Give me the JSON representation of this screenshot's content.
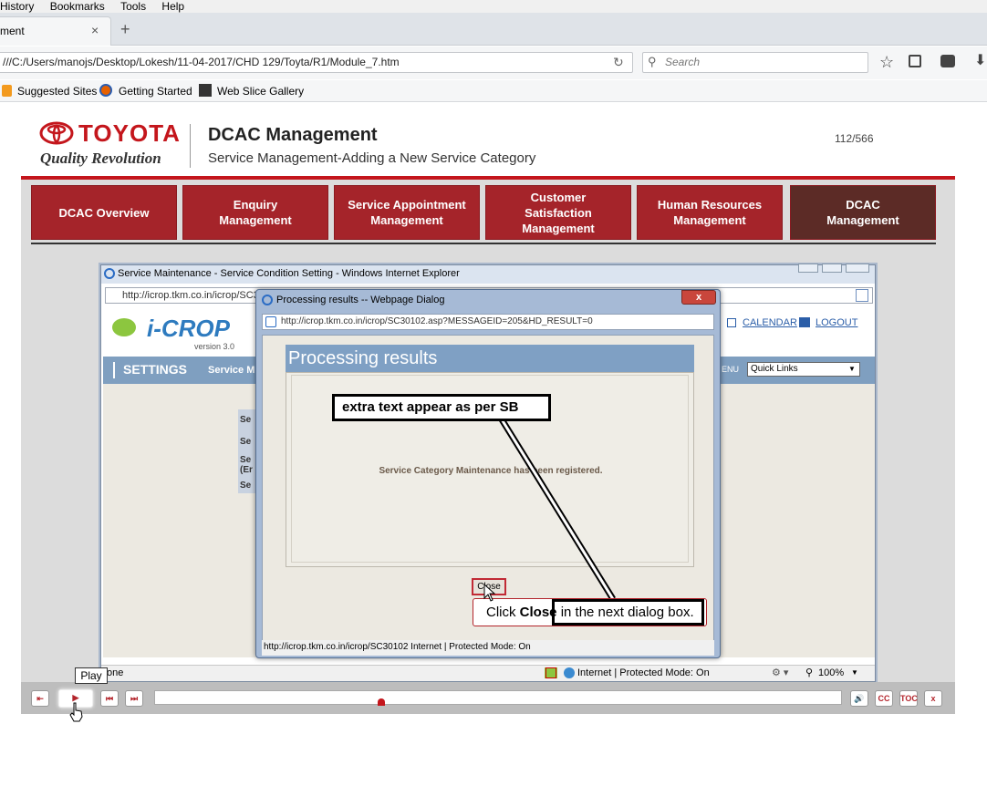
{
  "browser": {
    "menu": [
      "History",
      "Bookmarks",
      "Tools",
      "Help"
    ],
    "tab_title": "ment",
    "tab_close": "×",
    "new_tab": "+",
    "url": "///C:/Users/manojs/Desktop/Lokesh/11-04-2017/CHD 129/Toyta/R1/Module_7.htm",
    "search_placeholder": "Search",
    "bookmarks": [
      "Suggested Sites",
      "Getting Started",
      "Web Slice Gallery"
    ]
  },
  "course": {
    "brand": "TOYOTA",
    "tagline": "Quality Revolution",
    "title": "DCAC Management",
    "subtitle": "Service Management-Adding a New Service Category",
    "page_counter": "112/566",
    "expand_glyph": "»",
    "nav": [
      "DCAC Overview",
      "Enquiry Management",
      "Service Appointment Management",
      "Customer Satisfaction Management",
      "Human Resources Management",
      "DCAC Management"
    ]
  },
  "ie_window": {
    "title": "Service Maintenance - Service Condition Setting   - Windows Internet Explorer",
    "address": "http://icrop.tkm.co.in/icrop/SC31",
    "app_name": "i-CROP",
    "app_version": "version 3.0",
    "calendar": "CALENDAR",
    "logout": "LOGOUT",
    "settings": "SETTINGS",
    "service_crumb": "Service M",
    "menu_crumb": "ENU",
    "quick_links": "Quick Links",
    "side_items": [
      "Se",
      "Se",
      "Se",
      "(Er",
      "Se"
    ],
    "status_left": "one",
    "status_zone": "Internet | Protected Mode: On",
    "zoom": "100%"
  },
  "dialog": {
    "title": "Processing results -- Webpage Dialog",
    "close_glyph": "x",
    "address": "http://icrop.tkm.co.in/icrop/SC30102.asp?MESSAGEID=205&HD_RESULT=0",
    "heading": "Processing results",
    "message": "Service Category Maintenance has been registered.",
    "close_button": "Close",
    "status": "http://icrop.tkm.co.in/icrop/SC30102   Internet | Protected Mode: On"
  },
  "callouts": {
    "note": "extra text appear as per SB",
    "instruction_prefix": "Click ",
    "instruction_bold": "Close",
    "instruction_suffix": " in the next dialog box."
  },
  "player": {
    "tooltip": "Play",
    "cc": "CC",
    "toc": "TOC",
    "exit": "x",
    "progress": 0.33
  }
}
